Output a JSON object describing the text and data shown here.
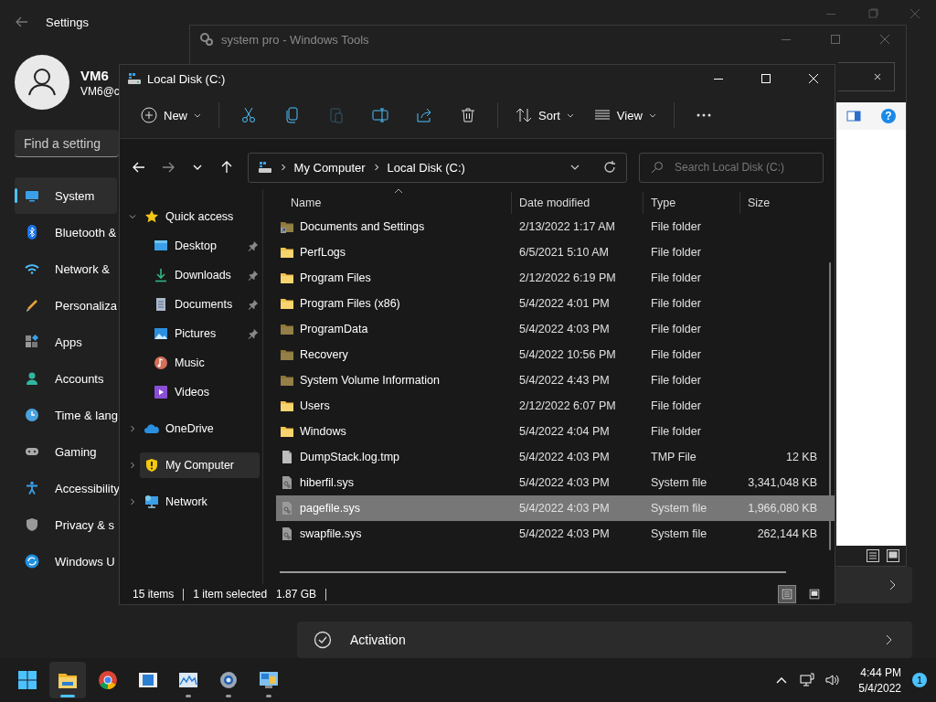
{
  "settings": {
    "title": "Settings",
    "user": {
      "name": "VM6",
      "email": "VM6@c"
    },
    "search": {
      "placeholder": "Find a setting"
    },
    "nav": [
      {
        "label": "System",
        "kind": "system",
        "selected": true
      },
      {
        "label": "Bluetooth &",
        "kind": "bluetooth",
        "selected": false
      },
      {
        "label": "Network &",
        "kind": "network",
        "selected": false
      },
      {
        "label": "Personaliza",
        "kind": "brush",
        "selected": false
      },
      {
        "label": "Apps",
        "kind": "apps",
        "selected": false
      },
      {
        "label": "Accounts",
        "kind": "accounts",
        "selected": false
      },
      {
        "label": "Time & lang",
        "kind": "time",
        "selected": false
      },
      {
        "label": "Gaming",
        "kind": "gaming",
        "selected": false
      },
      {
        "label": "Accessibility",
        "kind": "accessibility",
        "selected": false
      },
      {
        "label": "Privacy & s",
        "kind": "privacy",
        "selected": false
      },
      {
        "label": "Windows U",
        "kind": "update",
        "selected": false
      }
    ],
    "cards": [
      {
        "kind": "plain"
      },
      {
        "kind": "activation",
        "title": "Activation"
      }
    ]
  },
  "tools_window": {
    "title": "system pro - Windows Tools",
    "help": "?"
  },
  "explorer": {
    "title": "Local Disk (C:)",
    "toolbar": [
      {
        "kind": "new",
        "label": "New",
        "disabled": false
      },
      {
        "kind": "cut",
        "disabled": false
      },
      {
        "kind": "copy",
        "disabled": false
      },
      {
        "kind": "paste",
        "disabled": true
      },
      {
        "kind": "rename",
        "disabled": false
      },
      {
        "kind": "share",
        "disabled": false
      },
      {
        "kind": "delete",
        "disabled": false
      },
      {
        "kind": "sort",
        "label": "Sort",
        "disabled": false
      },
      {
        "kind": "view",
        "label": "View",
        "disabled": false
      },
      {
        "kind": "more",
        "disabled": false
      }
    ],
    "address": [
      "My Computer",
      "Local Disk (C:)"
    ],
    "search": {
      "placeholder": "Search Local Disk (C:)"
    },
    "nav": [
      {
        "label": "Quick access",
        "kind": "star",
        "expanded": true,
        "selected": false,
        "children": [
          {
            "label": "Desktop",
            "kind": "desktop",
            "pinned": true,
            "selected": false
          },
          {
            "label": "Downloads",
            "kind": "downloads",
            "pinned": true,
            "selected": false
          },
          {
            "label": "Documents",
            "kind": "documents",
            "pinned": true,
            "selected": false
          },
          {
            "label": "Pictures",
            "kind": "pictures",
            "pinned": true,
            "selected": false
          },
          {
            "label": "Music",
            "kind": "music",
            "pinned": false,
            "selected": false
          },
          {
            "label": "Videos",
            "kind": "videos",
            "pinned": false,
            "selected": false
          }
        ]
      },
      {
        "label": "OneDrive",
        "kind": "cloud",
        "expanded": false,
        "selected": false
      },
      {
        "label": "My Computer",
        "kind": "shield",
        "expanded": false,
        "selected": true
      },
      {
        "label": "Network",
        "kind": "network",
        "expanded": false,
        "selected": false
      }
    ],
    "columns": [
      {
        "label": "Name",
        "sorted": true
      },
      {
        "label": "Date modified",
        "sorted": false
      },
      {
        "label": "Type",
        "sorted": false
      },
      {
        "label": "Size",
        "sorted": false
      }
    ],
    "rows": [
      {
        "name": "Documents and Settings",
        "date": "2/13/2022 1:17 AM",
        "type": "File folder",
        "kind": "shortcut",
        "hidden": true,
        "selected": false
      },
      {
        "name": "PerfLogs",
        "date": "6/5/2021 5:10 AM",
        "type": "File folder",
        "kind": "folder",
        "hidden": false,
        "selected": false
      },
      {
        "name": "Program Files",
        "date": "2/12/2022 6:19 PM",
        "type": "File folder",
        "kind": "folder",
        "hidden": false,
        "selected": false
      },
      {
        "name": "Program Files (x86)",
        "date": "5/4/2022 4:01 PM",
        "type": "File folder",
        "kind": "folder",
        "hidden": false,
        "selected": false
      },
      {
        "name": "ProgramData",
        "date": "5/4/2022 4:03 PM",
        "type": "File folder",
        "kind": "folder",
        "hidden": true,
        "selected": false
      },
      {
        "name": "Recovery",
        "date": "5/4/2022 10:56 PM",
        "type": "File folder",
        "kind": "folder",
        "hidden": true,
        "selected": false
      },
      {
        "name": "System Volume Information",
        "date": "5/4/2022 4:43 PM",
        "type": "File folder",
        "kind": "folder",
        "hidden": true,
        "selected": false
      },
      {
        "name": "Users",
        "date": "2/12/2022 6:07 PM",
        "type": "File folder",
        "kind": "folder",
        "hidden": false,
        "selected": false
      },
      {
        "name": "Windows",
        "date": "5/4/2022 4:04 PM",
        "type": "File folder",
        "kind": "folder",
        "hidden": false,
        "selected": false
      },
      {
        "name": "DumpStack.log.tmp",
        "date": "5/4/2022 4:03 PM",
        "type": "TMP File",
        "size": "12 KB",
        "kind": "file",
        "hidden": false,
        "selected": false
      },
      {
        "name": "hiberfil.sys",
        "date": "5/4/2022 4:03 PM",
        "type": "System file",
        "size": "3,341,048 KB",
        "kind": "system",
        "hidden": false,
        "selected": false
      },
      {
        "name": "pagefile.sys",
        "date": "5/4/2022 4:03 PM",
        "type": "System file",
        "size": "1,966,080 KB",
        "kind": "system",
        "hidden": false,
        "selected": true
      },
      {
        "name": "swapfile.sys",
        "date": "5/4/2022 4:03 PM",
        "type": "System file",
        "size": "262,144 KB",
        "kind": "system",
        "hidden": false,
        "selected": false
      }
    ],
    "status": {
      "count": "15 items",
      "selection": "1 item selected",
      "size": "1.87 GB"
    },
    "views": [
      {
        "kind": "details",
        "selected": true
      },
      {
        "kind": "tiles",
        "selected": false
      }
    ]
  },
  "taskbar": {
    "apps": [
      {
        "kind": "start",
        "active": false,
        "running": false
      },
      {
        "kind": "explorer",
        "active": true,
        "running": true
      },
      {
        "kind": "browser",
        "active": false,
        "running": false
      },
      {
        "kind": "film",
        "active": false,
        "running": false
      },
      {
        "kind": "monitor",
        "active": false,
        "running": true
      },
      {
        "kind": "gear",
        "active": false,
        "running": true
      },
      {
        "kind": "panel",
        "active": false,
        "running": true
      }
    ],
    "time": "4:44 PM",
    "date": "5/4/2022",
    "badge": "1"
  }
}
